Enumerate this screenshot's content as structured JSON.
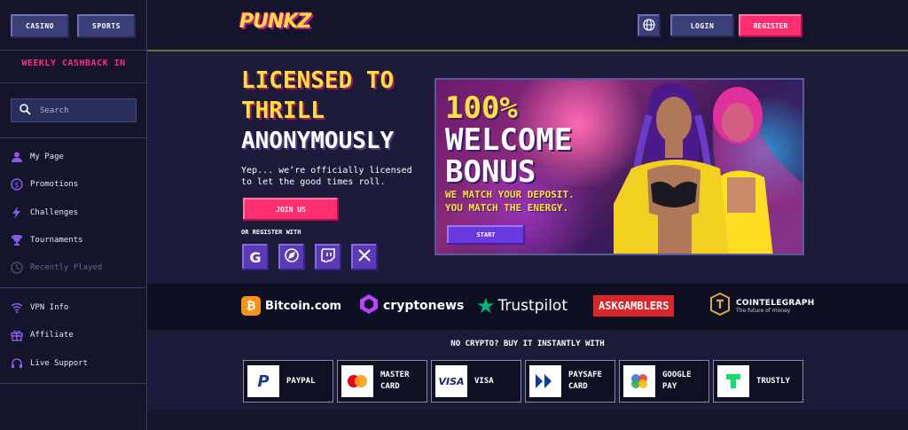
{
  "sidebar": {
    "casino_label": "CASINO",
    "sports_label": "SPORTS",
    "cashback_text": "WEEKLY CASHBACK IN",
    "search_placeholder": "Search",
    "nav_primary": [
      {
        "label": "My Page",
        "icon": "user-icon"
      },
      {
        "label": "Promotions",
        "icon": "dollar-icon"
      },
      {
        "label": "Challenges",
        "icon": "lightning-icon"
      },
      {
        "label": "Tournaments",
        "icon": "trophy-icon"
      },
      {
        "label": "Recently Played",
        "icon": "clock-icon"
      }
    ],
    "nav_secondary": [
      {
        "label": "VPN Info",
        "icon": "wifi-icon"
      },
      {
        "label": "Affiliate",
        "icon": "gift-icon"
      },
      {
        "label": "Live Support",
        "icon": "headset-icon"
      }
    ]
  },
  "header": {
    "logo_text": "PUNKZ",
    "login_label": "LOGIN",
    "register_label": "REGISTER"
  },
  "hero": {
    "title_line1": "LICENSED TO",
    "title_line2": "THRILL",
    "title_line3": "ANONYMOUSLY",
    "subtitle": "Yep... we’re officially licensed to let the good times roll.",
    "join_label": "JOIN US",
    "or_register": "OR REGISTER WITH"
  },
  "banner": {
    "line1": "100%",
    "line2": "WELCOME",
    "line3": "BONUS",
    "sub1": "WE MATCH YOUR DEPOSIT.",
    "sub2": "YOU MATCH THE ENERGY.",
    "start_label": "START"
  },
  "partners": {
    "bitcoin": "Bitcoin.com",
    "cryptonews": "cryptonews",
    "trustpilot": "Trustpilot",
    "askgamblers": "ASKGAMBLERS",
    "cointelegraph": "COINTELEGRAPH",
    "cointelegraph_sub": "The future of money"
  },
  "payments": {
    "title": "NO CRYPTO? BUY IT INSTANTLY WITH",
    "paypal": "PAYPAL",
    "mastercard_1": "MASTER",
    "mastercard_2": "CARD",
    "visa": "VISA",
    "paysafe_1": "PAYSAFE",
    "paysafe_2": "CARD",
    "googlepay_1": "GOOGLE",
    "googlepay_2": "PAY",
    "trustly": "TRUSTLY"
  },
  "colors": {
    "accent_pink": "#ff2e6e",
    "accent_yellow": "#ffe03a",
    "button_blue": "#3b3f78",
    "social_purple": "#5a3ab8"
  }
}
